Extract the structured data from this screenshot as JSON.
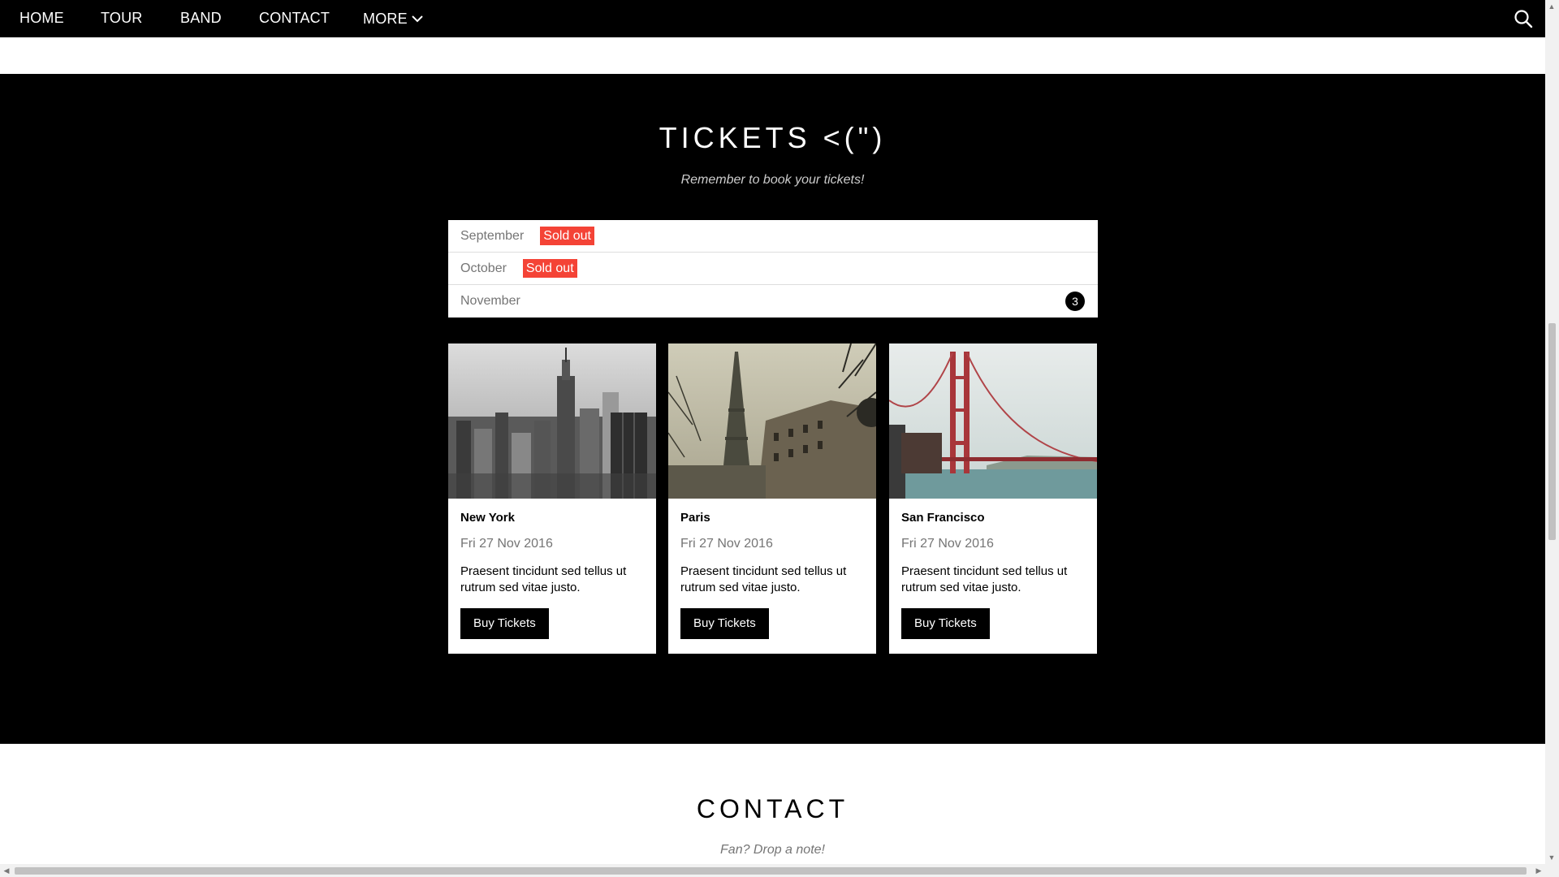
{
  "nav": {
    "items": [
      "HOME",
      "TOUR",
      "BAND",
      "CONTACT"
    ],
    "more_label": "MORE"
  },
  "tickets": {
    "title": "TICKETS <(\")",
    "subtitle": "Remember to book your tickets!",
    "months": [
      {
        "name": "September",
        "status": "Sold out"
      },
      {
        "name": "October",
        "status": "Sold out"
      },
      {
        "name": "November",
        "count": "3"
      }
    ],
    "cards": [
      {
        "city": "New York",
        "date": "Fri 27 Nov 2016",
        "text": "Praesent tincidunt sed tellus ut rutrum sed vitae justo.",
        "button": "Buy Tickets"
      },
      {
        "city": "Paris",
        "date": "Fri 27 Nov 2016",
        "text": "Praesent tincidunt sed tellus ut rutrum sed vitae justo.",
        "button": "Buy Tickets"
      },
      {
        "city": "San Francisco",
        "date": "Fri 27 Nov 2016",
        "text": "Praesent tincidunt sed tellus ut rutrum sed vitae justo.",
        "button": "Buy Tickets"
      }
    ]
  },
  "contact": {
    "title": "CONTACT",
    "subtitle": "Fan? Drop a note!"
  },
  "colors": {
    "accent_red": "#f44336",
    "nav_bg": "#000000"
  }
}
